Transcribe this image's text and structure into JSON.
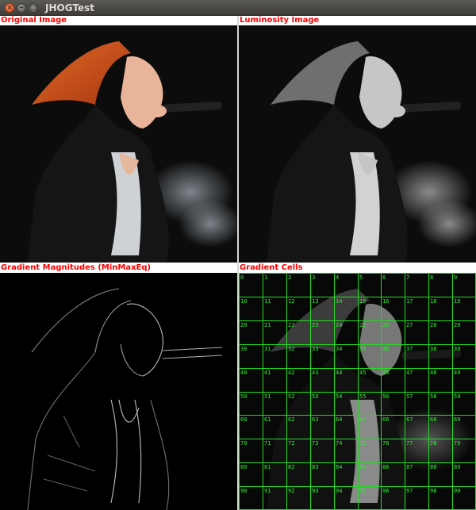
{
  "window": {
    "title": "JHOGTest",
    "close_glyph": "×",
    "minimize_glyph": "–",
    "maximize_glyph": "□"
  },
  "panels": [
    {
      "label": "Original Image"
    },
    {
      "label": "Luminosity Image"
    },
    {
      "label": "Gradient Magnitudes (MinMaxEq)"
    },
    {
      "label": "Gradient Cells"
    }
  ],
  "cells": {
    "rows": 10,
    "cols": 10,
    "grid_color": "#22dd22",
    "labels": [
      "0",
      "1",
      "2",
      "3",
      "4",
      "5",
      "6",
      "7",
      "8",
      "9",
      "10",
      "11",
      "12",
      "13",
      "14",
      "15",
      "16",
      "17",
      "18",
      "19",
      "20",
      "21",
      "22",
      "23",
      "24",
      "25",
      "26",
      "27",
      "28",
      "29",
      "30",
      "31",
      "32",
      "33",
      "34",
      "35",
      "36",
      "37",
      "38",
      "39",
      "40",
      "41",
      "42",
      "43",
      "44",
      "45",
      "46",
      "47",
      "48",
      "49",
      "50",
      "51",
      "52",
      "53",
      "54",
      "55",
      "56",
      "57",
      "58",
      "59",
      "60",
      "61",
      "62",
      "63",
      "64",
      "65",
      "66",
      "67",
      "68",
      "69",
      "70",
      "71",
      "72",
      "73",
      "74",
      "75",
      "76",
      "77",
      "78",
      "79",
      "80",
      "81",
      "82",
      "83",
      "84",
      "85",
      "86",
      "87",
      "88",
      "89",
      "90",
      "91",
      "92",
      "93",
      "94",
      "95",
      "96",
      "97",
      "98",
      "99"
    ]
  },
  "colors": {
    "label_text": "#ff0000",
    "hair": "#d2521c"
  }
}
